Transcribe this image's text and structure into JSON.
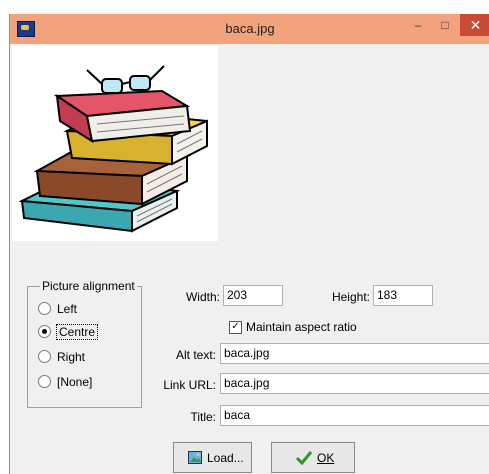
{
  "window": {
    "title": "baca.jpg"
  },
  "titlebar": {
    "minimize": "‒",
    "maximize": "□",
    "close": "✕"
  },
  "alignment": {
    "legend": "Picture alignment",
    "options": [
      {
        "label": "Left",
        "checked": false
      },
      {
        "label": "Centre",
        "checked": true
      },
      {
        "label": "Right",
        "checked": false
      },
      {
        "label": "[None]",
        "checked": false
      }
    ]
  },
  "size": {
    "width_label": "Width:",
    "width_value": "203",
    "height_label": "Height:",
    "height_value": "183",
    "aspect_label": "Maintain aspect ratio",
    "aspect_checked": true
  },
  "fields": {
    "alt_label": "Alt text:",
    "alt_value": "baca.jpg",
    "link_label": "Link URL:",
    "link_value": "baca.jpg",
    "title_label": "Title:",
    "title_value": "baca"
  },
  "buttons": {
    "load": "Load...",
    "ok": "OK"
  },
  "icons": {
    "load": "picture-icon",
    "ok": "checkmark-icon"
  }
}
